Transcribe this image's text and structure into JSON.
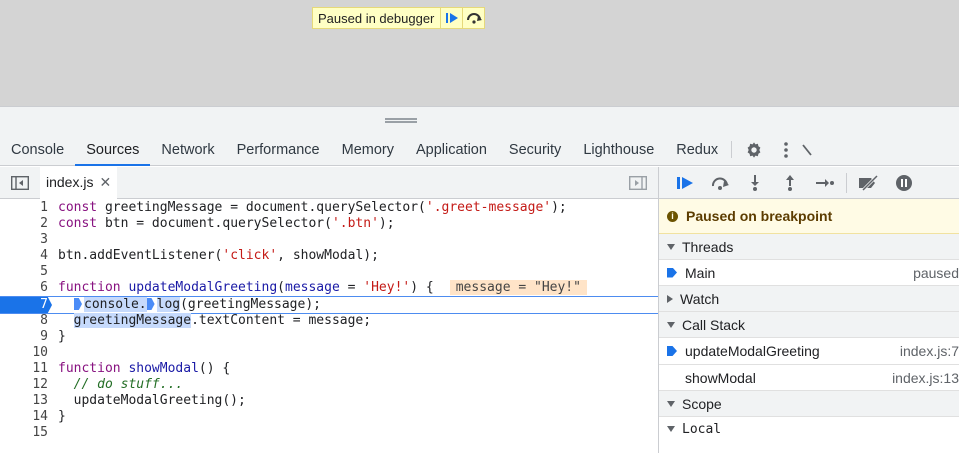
{
  "viewport": {
    "paused_banner": "Paused in debugger"
  },
  "tabs": [
    {
      "label": "Console",
      "active": false
    },
    {
      "label": "Sources",
      "active": true
    },
    {
      "label": "Network",
      "active": false
    },
    {
      "label": "Performance",
      "active": false
    },
    {
      "label": "Memory",
      "active": false
    },
    {
      "label": "Application",
      "active": false
    },
    {
      "label": "Security",
      "active": false
    },
    {
      "label": "Lighthouse",
      "active": false
    },
    {
      "label": "Redux",
      "active": false
    }
  ],
  "editor": {
    "file_tab": "index.js",
    "current_line": 7,
    "lines": [
      "const greetingMessage = document.querySelector('.greet-message');",
      "const btn = document.querySelector('.btn');",
      "",
      "btn.addEventListener('click', showModal);",
      "",
      "function updateModalGreeting(message = 'Hey!') {",
      "  console.log(greetingMessage);",
      "  greetingMessage.textContent = message;",
      "}",
      "",
      "function showModal() {",
      "  // do stuff...",
      "  updateModalGreeting();",
      "}",
      ""
    ],
    "inline_value": "message = \"Hey!\""
  },
  "debugger": {
    "paused_message": "Paused on breakpoint",
    "threads_label": "Threads",
    "threads": [
      {
        "name": "Main",
        "status": "paused"
      }
    ],
    "watch_label": "Watch",
    "call_stack_label": "Call Stack",
    "call_stack": [
      {
        "name": "updateModalGreeting",
        "location": "index.js:7",
        "current": true
      },
      {
        "name": "showModal",
        "location": "index.js:13",
        "current": false
      }
    ],
    "scope_label": "Scope",
    "scope_local": "Local"
  },
  "colors": {
    "accent": "#1a73e8",
    "paused_banner_bg": "#ffffc4",
    "paused_msg_bg": "#fffbe5"
  }
}
